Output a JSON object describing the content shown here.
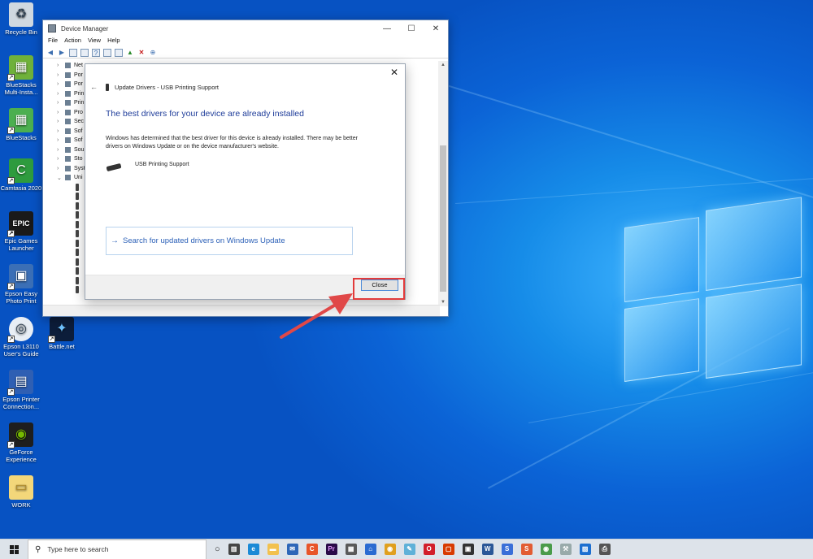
{
  "desktop": {
    "icons": [
      {
        "label": "Recycle Bin",
        "color": "#cfd8e0",
        "glyph": "♻"
      },
      {
        "label": "BlueStacks Multi-Insta...",
        "color": "#6fb13a",
        "glyph": "▦"
      },
      {
        "label": "BlueStacks",
        "color": "#4caf50",
        "glyph": "▦"
      },
      {
        "label": "Camtasia 2020",
        "color": "#2e9b3e",
        "glyph": "C"
      },
      {
        "label": "Epic Games Launcher",
        "color": "#1a1a1a",
        "glyph": "EPIC"
      },
      {
        "label": "Epson Easy Photo Print",
        "color": "#3b6fb6",
        "glyph": "▣"
      },
      {
        "label": "Epson L3110 User's Guide",
        "color": "#e8eef5",
        "glyph": "◎"
      },
      {
        "label": "Battle.net",
        "color": "#0c1d3a",
        "glyph": "✦"
      },
      {
        "label": "Epson Printer Connection...",
        "color": "#2f5fb3",
        "glyph": "▤"
      },
      {
        "label": "GeForce Experience",
        "color": "#1e1e1e",
        "glyph": "◉"
      },
      {
        "label": "WORK",
        "color": "#f3d77a",
        "glyph": "▭"
      }
    ]
  },
  "device_manager": {
    "title": "Device Manager",
    "menu": [
      "File",
      "Action",
      "View",
      "Help"
    ],
    "tree": [
      "Net",
      "Por",
      "Por",
      "Prin",
      "Prin",
      "Pro",
      "Sec",
      "Sof",
      "Sof",
      "Sou",
      "Sto",
      "Syst",
      "Uni"
    ]
  },
  "dialog": {
    "header": "Update Drivers - USB Printing Support",
    "heading": "The best drivers for your device are already installed",
    "body": "Windows has determined that the best driver for this device is already installed. There may be better drivers on Windows Update or on the device manufacturer's website.",
    "device": "USB Printing Support",
    "link": "Search for updated drivers on Windows Update",
    "close_label": "Close",
    "accent_color": "#1f3d9a"
  },
  "taskbar": {
    "search_placeholder": "Type here to search",
    "apps": [
      {
        "name": "task-view",
        "color": "#444",
        "glyph": "▥"
      },
      {
        "name": "edge",
        "color": "#1b8ad6",
        "glyph": "e"
      },
      {
        "name": "file-explorer",
        "color": "#f2c14e",
        "glyph": "▬"
      },
      {
        "name": "mail",
        "color": "#2e67b8",
        "glyph": "✉"
      },
      {
        "name": "app-c",
        "color": "#e8552a",
        "glyph": "C"
      },
      {
        "name": "premiere",
        "color": "#2a0a48",
        "glyph": "Pr"
      },
      {
        "name": "calculator",
        "color": "#5a5a5a",
        "glyph": "▦"
      },
      {
        "name": "store",
        "color": "#2b6bd1",
        "glyph": "⌂"
      },
      {
        "name": "chrome",
        "color": "#e0a020",
        "glyph": "◉"
      },
      {
        "name": "note",
        "color": "#5fb1d8",
        "glyph": "✎"
      },
      {
        "name": "opera",
        "color": "#d21e2a",
        "glyph": "O"
      },
      {
        "name": "office",
        "color": "#d83b01",
        "glyph": "▢"
      },
      {
        "name": "bag",
        "color": "#333",
        "glyph": "▣"
      },
      {
        "name": "word",
        "color": "#2b5797",
        "glyph": "W"
      },
      {
        "name": "app-s",
        "color": "#3a6fd8",
        "glyph": "S"
      },
      {
        "name": "app-s2",
        "color": "#e25c33",
        "glyph": "S"
      },
      {
        "name": "chrome2",
        "color": "#4a9b4a",
        "glyph": "◉"
      },
      {
        "name": "tool",
        "color": "#9aa",
        "glyph": "⚒"
      },
      {
        "name": "photos",
        "color": "#1d6fd0",
        "glyph": "▨"
      },
      {
        "name": "printer",
        "color": "#555",
        "glyph": "⎙"
      }
    ]
  }
}
